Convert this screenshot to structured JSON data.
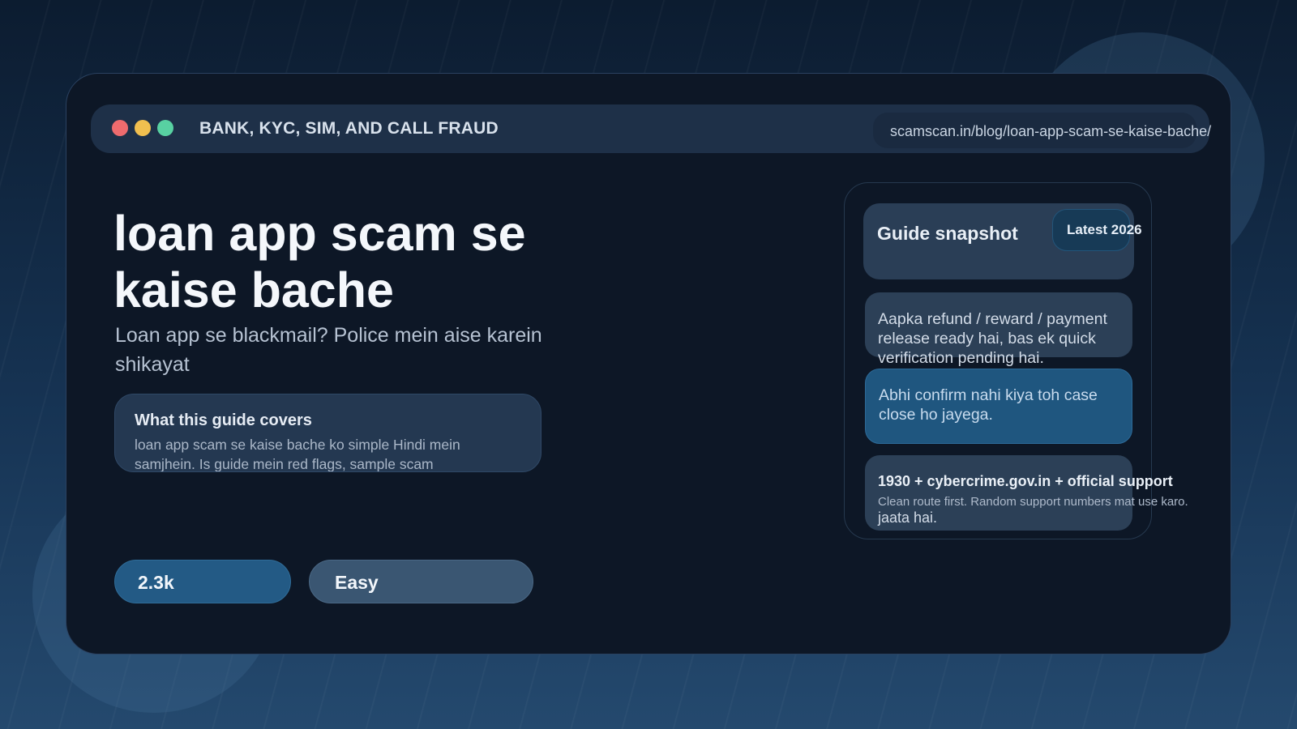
{
  "window": {
    "title": "BANK, KYC, SIM, AND CALL FRAUD",
    "url": "scamscan.in/blog/loan-app-scam-se-kaise-bache/"
  },
  "article": {
    "headline": "loan app scam se kaise bache",
    "subtitle": "Loan app se blackmail? Police mein aise karein shikayat",
    "covers": {
      "title": "What this guide covers",
      "text": "loan app scam se kaise bache ko simple Hindi mein samjhein. Is guide mein red flags, sample scam"
    },
    "stats": {
      "views": "2.3k",
      "level": "Easy"
    }
  },
  "snapshot": {
    "title": "Guide snapshot",
    "badge": "Latest 2026",
    "message_1": "Aapka refund / reward / payment release ready hai, bas ek quick verification pending hai.",
    "message_2": "Abhi confirm nahi kiya toh case close ho jayega.",
    "support": {
      "title": "1930 + cybercrime.gov.in + official support",
      "note": "Clean route first. Random support numbers mat use karo.",
      "tail": "jaata hai."
    }
  },
  "colors": {
    "dot_red": "#ee6b6e",
    "dot_yellow": "#f1bf4f",
    "dot_green": "#58d1a2",
    "accent_blue": "#235a85",
    "window_bg": "#0d1726"
  }
}
